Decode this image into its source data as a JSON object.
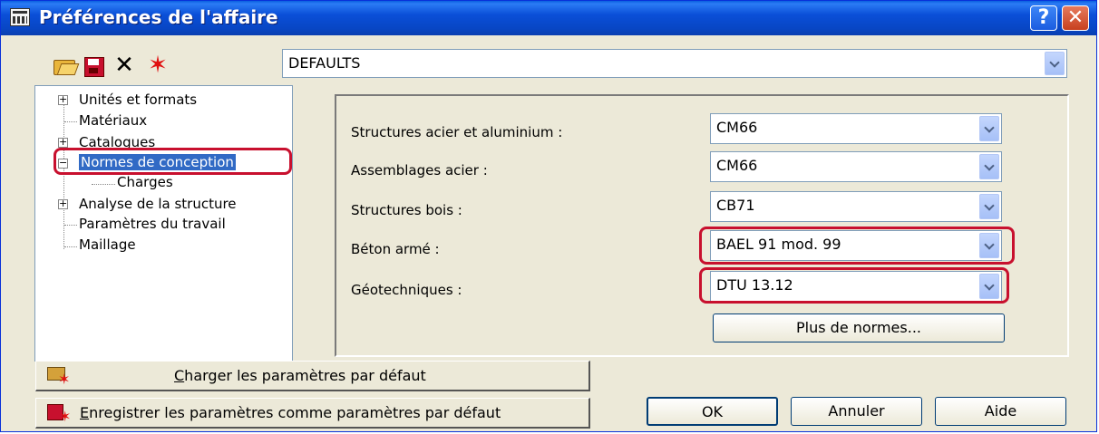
{
  "window": {
    "title": "Préférences de l'affaire",
    "help_label": "?",
    "close_label": "✕"
  },
  "toolbar": {
    "icons": [
      "open-folder-icon",
      "save-icon",
      "delete-icon",
      "new-default-icon"
    ],
    "delete_glyph": "✕",
    "new_glyph": "✶"
  },
  "preset": {
    "value": "DEFAULTS"
  },
  "tree": {
    "items": [
      {
        "label": "Unités et formats",
        "expandable": true
      },
      {
        "label": "Matériaux",
        "expandable": false
      },
      {
        "label": "Catalogues",
        "expandable": true
      },
      {
        "label": "Normes de conception",
        "expandable": true,
        "expanded": true,
        "selected": true
      },
      {
        "label": "Charges",
        "expandable": false,
        "child": true
      },
      {
        "label": "Analyse de la structure",
        "expandable": true
      },
      {
        "label": "Paramètres du travail",
        "expandable": false
      },
      {
        "label": "Maillage",
        "expandable": false
      }
    ],
    "expander_plus": "+",
    "expander_minus": "−"
  },
  "norms": [
    {
      "label": "Structures acier et aluminium :",
      "value": "CM66"
    },
    {
      "label": "Assemblages acier :",
      "value": "CM66"
    },
    {
      "label": "Structures bois :",
      "value": "CB71"
    },
    {
      "label": "Béton armé :",
      "value": "BAEL 91 mod. 99",
      "highlighted": true
    },
    {
      "label": "Géotechniques :",
      "value": "DTU 13.12",
      "highlighted": true
    }
  ],
  "buttons": {
    "more_norms": "Plus de normes...",
    "load_defaults_first": "C",
    "load_defaults_rest": "harger les paramètres par défaut",
    "save_defaults_first": "E",
    "save_defaults_rest": "nregistrer les paramètres comme paramètres par défaut",
    "ok": "OK",
    "cancel": "Annuler",
    "help": "Aide"
  },
  "colors": {
    "titlebar": "#0a4fd8",
    "dialog_bg": "#ece9d8",
    "selection": "#316ac5",
    "highlight_circle": "#c8102e"
  }
}
